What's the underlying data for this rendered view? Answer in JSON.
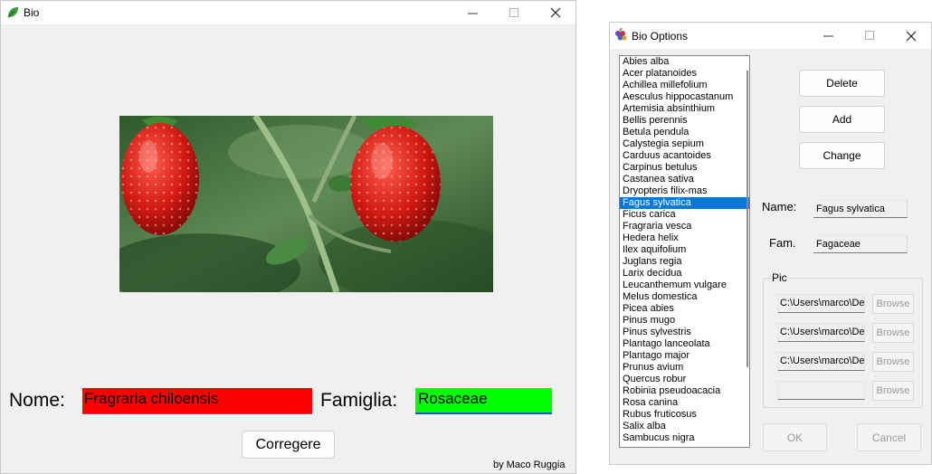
{
  "bio_window": {
    "title": "Bio",
    "app_icon": "leaf-icon",
    "nome_label": "Nome:",
    "nome_value": "Fragraria chiloensis",
    "famiglia_label": "Famiglia:",
    "famiglia_value": "Rosaceae",
    "correct_button": "Corregere",
    "byline": "by Maco Ruggia",
    "colors": {
      "nome_bg": "#ff0000",
      "famiglia_bg": "#00ff00"
    }
  },
  "options_window": {
    "title": "Bio Options",
    "app_icon": "grape-icon",
    "species": [
      "Abies alba",
      "Acer platanoides",
      "Achillea millefolium",
      "Aesculus hippocastanum",
      "Artemisia absinthium",
      "Bellis perennis",
      "Betula pendula",
      "Calystegia sepium",
      "Carduus acantoides",
      "Carpinus betulus",
      "Castanea sativa",
      "Dryopteris filix-mas",
      "Fagus sylvatica",
      "Ficus carica",
      "Fragraria vesca",
      "Hedera helix",
      "Ilex aquifolium",
      "Juglans regia",
      "Larix decidua",
      "Leucanthemum vulgare",
      "Melus domestica",
      "Picea abies",
      "Pinus mugo",
      "Pinus sylvestris",
      "Plantago lanceolata",
      "Plantago major",
      "Prunus avium",
      "Quercus robur",
      "Robinia pseudoacacia",
      "Rosa canina",
      "Rubus fruticosus",
      "Salix alba",
      "Sambucus nigra"
    ],
    "selected_species": "Fagus sylvatica",
    "delete_button": "Delete",
    "add_button": "Add",
    "change_button": "Change",
    "name_label": "Name:",
    "name_value": "Fagus sylvatica",
    "fam_label": "Fam.",
    "fam_value": "Fagaceae",
    "pic_group_label": "Pic",
    "pic_paths": [
      "C:\\Users\\marco\\De",
      "C:\\Users\\marco\\De",
      "C:\\Users\\marco\\De",
      ""
    ],
    "browse_label": "Browse",
    "ok_button": "OK",
    "cancel_button": "Cancel"
  }
}
